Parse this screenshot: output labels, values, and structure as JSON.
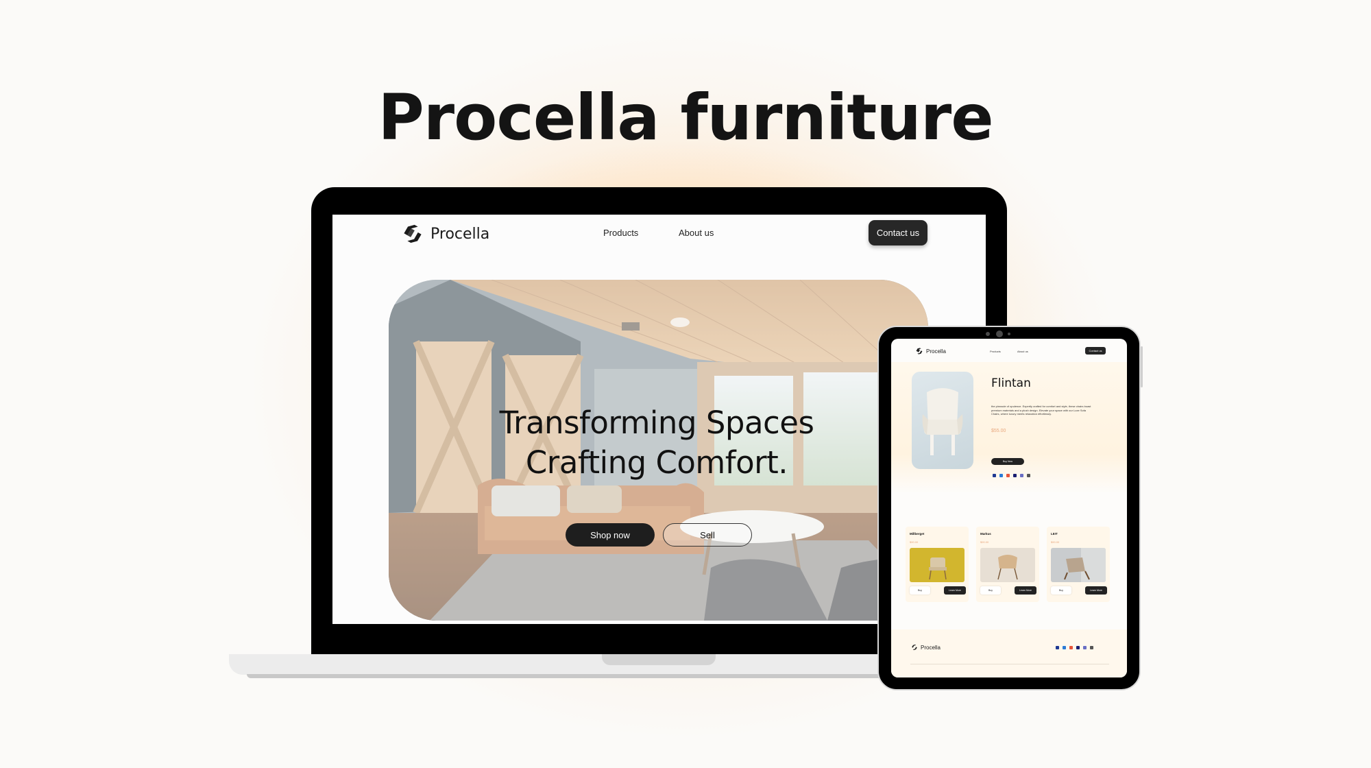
{
  "title": "Procella furniture",
  "laptop": {
    "brand": "Procella",
    "nav": {
      "products": "Products",
      "about": "About us",
      "contact": "Contact us"
    },
    "hero": {
      "line1": "Transforming Spaces",
      "line2": "Crafting Comfort.",
      "shop_label": "Shop now",
      "sell_label": "Sell"
    }
  },
  "tablet": {
    "brand": "Procella",
    "nav": {
      "products": "Products",
      "about": "About us",
      "contact": "Contact us"
    },
    "product": {
      "name": "Flintan",
      "description": "the pinnacle of opulence. Expertly crafted for comfort and style, these chairs boast premium materials and a plush design. Elevate your space with our Luxe Sofa Chairs, where luxury meets relaxation effortlessly.",
      "price": "$55.00",
      "buy_label": "Buy Now"
    },
    "cards": [
      {
        "name": "Millberget",
        "price": "$90.00",
        "buy_label": "Buy",
        "learn_label": "Learn More"
      },
      {
        "name": "Markus",
        "price": "$90.00",
        "buy_label": "Buy",
        "learn_label": "Learn More"
      },
      {
        "name": "LEIT",
        "price": "$90.00",
        "buy_label": "Buy",
        "learn_label": "Learn More"
      }
    ],
    "footer_brand": "Procella"
  },
  "colors": {
    "accent_dark": "#1e1e1e",
    "price": "#e8a77d",
    "glow": "#ffc480",
    "cream": "#fff7ea"
  }
}
